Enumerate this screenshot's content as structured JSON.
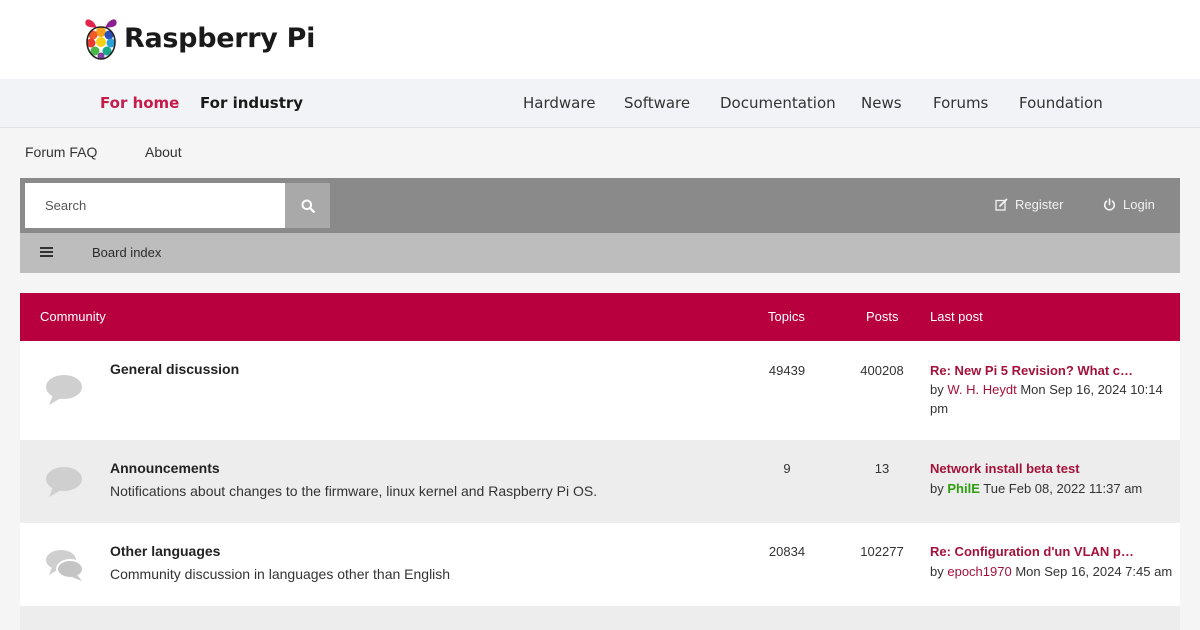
{
  "brand": {
    "name": "Raspberry Pi"
  },
  "main_nav": {
    "for_home": "For home",
    "for_industry": "For industry",
    "items": [
      "Hardware",
      "Software",
      "Documentation",
      "News",
      "Forums",
      "Foundation"
    ]
  },
  "sub_nav": {
    "faq": "Forum FAQ",
    "about": "About"
  },
  "search": {
    "placeholder": "Search",
    "icon": "search-icon"
  },
  "account": {
    "register": "Register",
    "login": "Login"
  },
  "breadcrumb": {
    "board_index": "Board index"
  },
  "forum": {
    "headers": {
      "name": "Community",
      "topics": "Topics",
      "posts": "Posts",
      "last_post": "Last post"
    },
    "rows": [
      {
        "title": "General discussion",
        "description": "",
        "topics": "49439",
        "posts": "400208",
        "last_title": "Re: New Pi 5 Revision? What c…",
        "by": "by",
        "user": "W. H. Heydt",
        "date": "Mon Sep 16, 2024 10:14 pm"
      },
      {
        "title": "Announcements",
        "description": "Notifications about changes to the firmware, linux kernel and Raspberry Pi OS.",
        "topics": "9",
        "posts": "13",
        "last_title": "Network install beta test",
        "by": "by",
        "user": "PhilE",
        "date": "Tue Feb 08, 2022 11:37 am"
      },
      {
        "title": "Other languages",
        "description": "Community discussion in languages other than English",
        "topics": "20834",
        "posts": "102277",
        "last_title": "Re: Configuration d'un VLAN p…",
        "by": "by",
        "user": "epoch1970",
        "date": "Mon Sep 16, 2024 7:45 am"
      }
    ]
  },
  "colors": {
    "accent": "#c51a4a",
    "header_bar": "#b8003f",
    "moderator": "#2e9e0f"
  }
}
